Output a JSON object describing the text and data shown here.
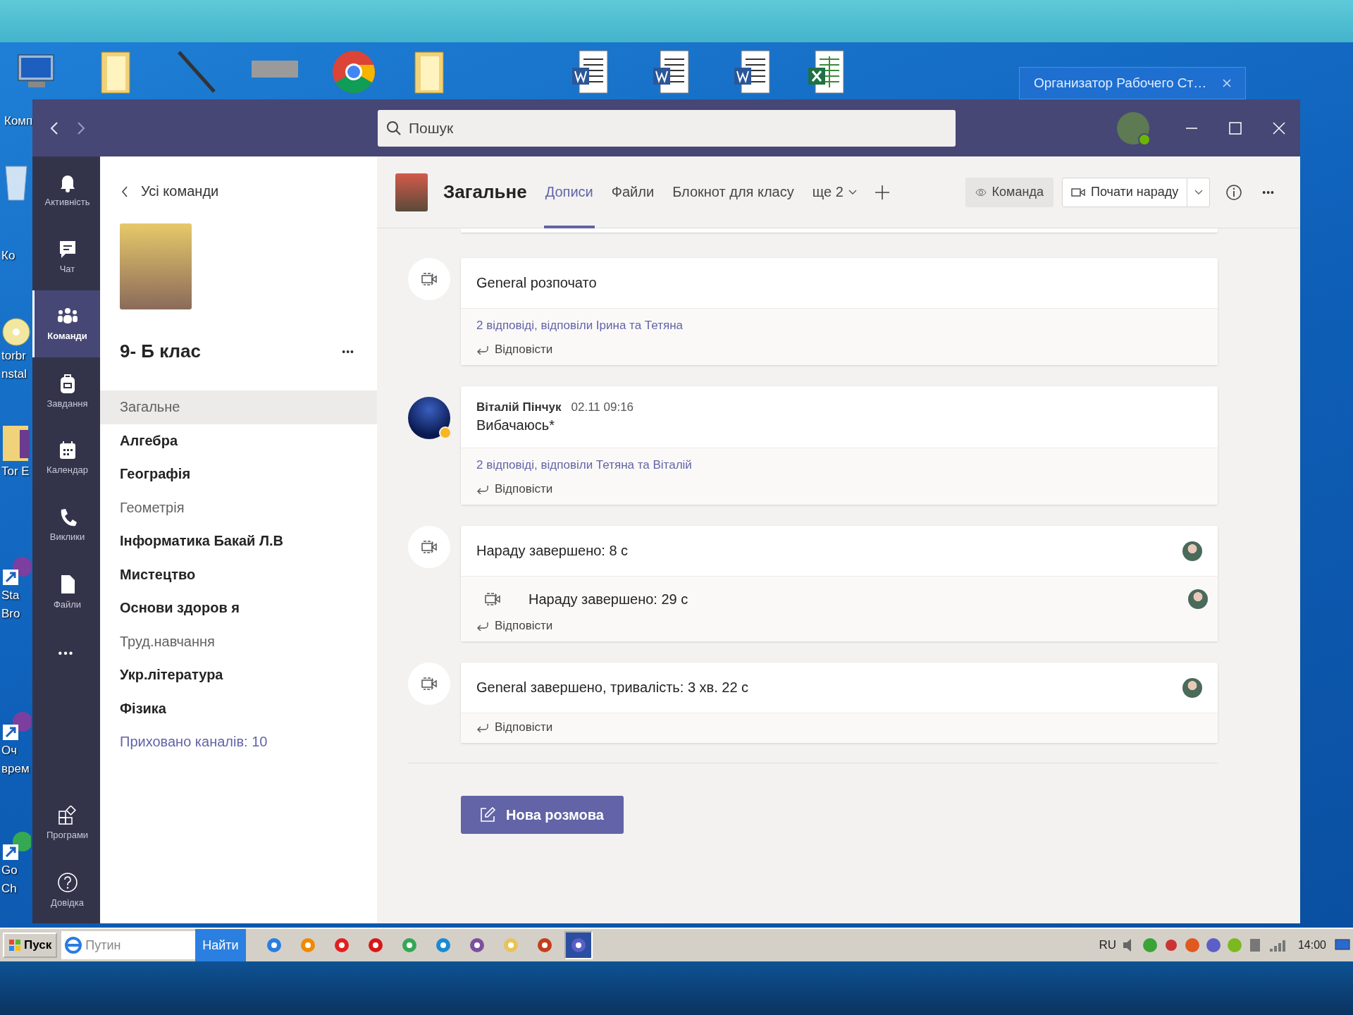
{
  "desktop": {
    "top_icons": [
      {
        "kind": "computer",
        "lines": [
          "Комп"
        ]
      },
      {
        "kind": "folder"
      },
      {
        "kind": "tool"
      },
      {
        "kind": "picture"
      },
      {
        "kind": "chrome"
      },
      {
        "kind": "folder"
      },
      {
        "kind": "word"
      },
      {
        "kind": "word"
      },
      {
        "kind": "word"
      },
      {
        "kind": "excel"
      }
    ],
    "side_icons": [
      {
        "kind": "bin",
        "lines": [
          "Ко"
        ]
      },
      {
        "kind": "disc",
        "lines": [
          "torbr",
          "nstal"
        ]
      },
      {
        "kind": "folder",
        "lines": [
          "Tor E"
        ]
      },
      {
        "kind": "shortcut",
        "lines": [
          "Sta",
          "Bro"
        ]
      },
      {
        "kind": "shortcut",
        "lines": [
          "Оч",
          "врем"
        ]
      },
      {
        "kind": "chrome",
        "lines": [
          "Go",
          "Ch"
        ]
      }
    ],
    "notification": {
      "title": "Организатор Рабочего Ст…"
    }
  },
  "window": {
    "search": {
      "placeholder": "Пошук"
    }
  },
  "rail": {
    "items": [
      {
        "label": "Активність",
        "kind": "bell",
        "selected": false
      },
      {
        "label": "Чат",
        "kind": "chat",
        "selected": false
      },
      {
        "label": "Команди",
        "kind": "teams",
        "selected": true
      },
      {
        "label": "Завдання",
        "kind": "bag",
        "selected": false
      },
      {
        "label": "Календар",
        "kind": "calendar",
        "selected": false
      },
      {
        "label": "Виклики",
        "kind": "phone",
        "selected": false
      },
      {
        "label": "Файли",
        "kind": "file",
        "selected": false
      }
    ],
    "more": "•••",
    "bottom_items": [
      {
        "label": "Програми",
        "kind": "apps",
        "selected": false
      },
      {
        "label": "Довідка",
        "kind": "help",
        "selected": false
      }
    ]
  },
  "team_panel": {
    "back": "Усі команди",
    "team_name": "9- Б клас",
    "more": "•••",
    "channels": [
      {
        "name": "Загальне",
        "unread": false,
        "selected": true
      },
      {
        "name": "Алгебра",
        "unread": true,
        "selected": false
      },
      {
        "name": "Географія",
        "unread": true,
        "selected": false
      },
      {
        "name": "Геометрія",
        "unread": false,
        "selected": false
      },
      {
        "name": "Інформатика Бакай Л.В",
        "unread": true,
        "selected": false
      },
      {
        "name": "Мистецтво",
        "unread": true,
        "selected": false
      },
      {
        "name": "Основи здоров я",
        "unread": true,
        "selected": false
      },
      {
        "name": "Труд.навчання",
        "unread": false,
        "selected": false
      },
      {
        "name": "Укр.література",
        "unread": true,
        "selected": false
      },
      {
        "name": "Фізика",
        "unread": true,
        "selected": false
      }
    ],
    "hidden_link": "Приховано каналів: 10"
  },
  "channel_header": {
    "title": "Загальне",
    "tabs": [
      {
        "label": "Дописи",
        "selected": true
      },
      {
        "label": "Файли",
        "selected": false
      },
      {
        "label": "Блокнот для класу",
        "selected": false
      }
    ],
    "more_tabs": "ще 2",
    "team_button": "Команда",
    "meet_button": "Почати нараду",
    "more": "•••"
  },
  "messages": [
    {
      "kind": "system",
      "title": "General розпочато",
      "has_avatar": false,
      "replies_link": "2 відповіді, відповіли Ірина та Тетяна",
      "reply": "Відповісти"
    },
    {
      "kind": "post",
      "author": "Віталій Пінчук",
      "time": "02.11 09:16",
      "text": "Вибачаюсь*",
      "away": true,
      "replies_link": "2 відповіді, відповіли Тетяна та Віталій",
      "reply": "Відповісти"
    },
    {
      "kind": "system",
      "title": "Нараду завершено: 8 с",
      "has_avatar": true,
      "nested": [
        {
          "title": "Нараду завершено: 29 с",
          "has_avatar": true
        }
      ],
      "reply": "Відповісти"
    },
    {
      "kind": "system",
      "title": "General завершено, тривалість: 3 хв. 22 с",
      "has_avatar": true,
      "reply": "Відповісти"
    }
  ],
  "new_conversation_button": "Нова розмова",
  "taskbar": {
    "start": "Пуск",
    "address_value": "Путин",
    "go_button": "Найти",
    "apps": [
      {
        "kind": "ie",
        "selected": false
      },
      {
        "kind": "media",
        "selected": false
      },
      {
        "kind": "yandex",
        "selected": false
      },
      {
        "kind": "opera",
        "selected": false
      },
      {
        "kind": "chrome",
        "selected": false
      },
      {
        "kind": "edge",
        "selected": false
      },
      {
        "kind": "viber",
        "selected": false
      },
      {
        "kind": "folder",
        "selected": false
      },
      {
        "kind": "powerpoint",
        "selected": false
      },
      {
        "kind": "teams",
        "selected": true
      }
    ],
    "language": "RU",
    "clock": "14:00"
  }
}
